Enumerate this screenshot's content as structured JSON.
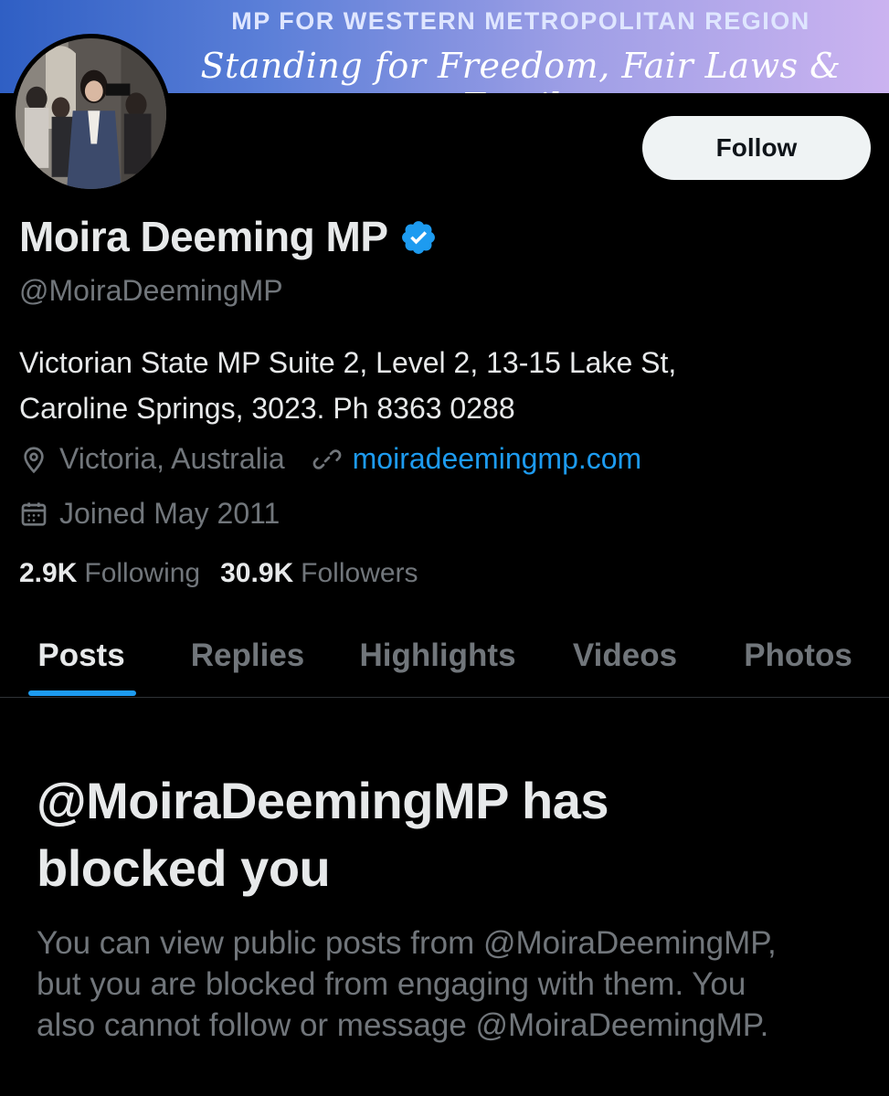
{
  "banner": {
    "line1": "MP FOR WESTERN METROPOLITAN REGION",
    "line2": "Standing for Freedom, Fair Laws & Family"
  },
  "profile": {
    "name": "Moira Deeming MP",
    "handle": "@MoiraDeemingMP",
    "verified": true,
    "bio_line1": "Victorian State MP Suite 2, Level 2, 13-15 Lake St,",
    "bio_line2": "Caroline Springs, 3023. Ph 8363 0288",
    "location": "Victoria, Australia",
    "website": "moiradeemingmp.com",
    "joined": "Joined May 2011",
    "following_count": "2.9K",
    "following_label": "Following",
    "followers_count": "30.9K",
    "followers_label": "Followers"
  },
  "actions": {
    "follow_label": "Follow"
  },
  "tabs": [
    {
      "label": "Posts",
      "active": true
    },
    {
      "label": "Replies",
      "active": false
    },
    {
      "label": "Highlights",
      "active": false
    },
    {
      "label": "Videos",
      "active": false
    },
    {
      "label": "Photos",
      "active": false
    }
  ],
  "blocked": {
    "title_line1": "@MoiraDeemingMP has",
    "title_line2": "blocked you",
    "desc_line1": "You can view public posts from @MoiraDeemingMP,",
    "desc_line2": "but you are blocked from engaging with them. You",
    "desc_line3": "also cannot follow or message @MoiraDeemingMP."
  },
  "icons": {
    "verified": "verified-badge-icon",
    "location": "location-pin-icon",
    "link": "link-icon",
    "calendar": "calendar-icon"
  },
  "colors": {
    "background": "#000000",
    "accent": "#1d9bf0",
    "text_primary": "#e7e9ea",
    "text_secondary": "#71767b",
    "button_bg": "#eff3f4"
  }
}
